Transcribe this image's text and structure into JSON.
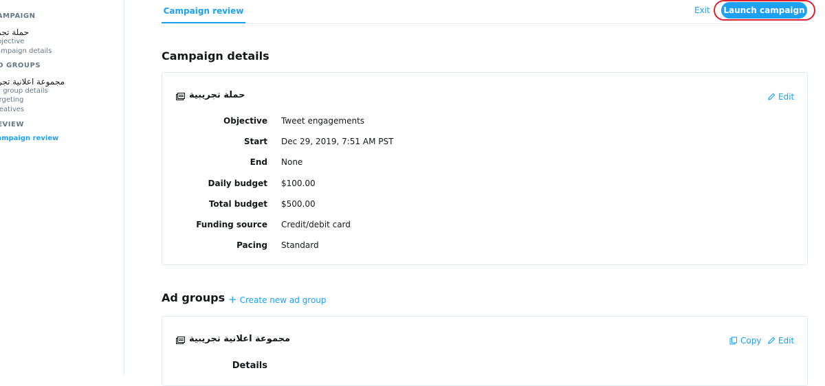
{
  "sidebar": {
    "campaign_heading": "CAMPAIGN",
    "campaign_name": "حملة تجريبية",
    "campaign_items": [
      "Objective",
      "Campaign details"
    ],
    "groups_heading": "AD GROUPS",
    "group_name": "مجموعة اعلانية تجريبية",
    "group_items": [
      "Ad group details",
      "Targeting",
      "Creatives"
    ],
    "review_heading": "REVIEW",
    "review_items": [
      "Campaign review"
    ]
  },
  "header": {
    "tab_label": "Campaign review",
    "exit_label": "Exit",
    "launch_label": "Launch campaign"
  },
  "campaign_details": {
    "heading": "Campaign details",
    "name": "حملة تجريبية",
    "edit_label": "Edit",
    "rows": [
      {
        "label": "Objective",
        "value": "Tweet engagements"
      },
      {
        "label": "Start",
        "value": "Dec 29, 2019, 7:51 AM PST"
      },
      {
        "label": "End",
        "value": "None"
      },
      {
        "label": "Daily budget",
        "value": "$100.00"
      },
      {
        "label": "Total budget",
        "value": "$500.00"
      },
      {
        "label": "Funding source",
        "value": "Credit/debit card"
      },
      {
        "label": "Pacing",
        "value": "Standard"
      }
    ]
  },
  "ad_groups": {
    "heading": "Ad groups",
    "create_label": "Create new ad group",
    "group_name": "مجموعة اعلانية تجريبية",
    "copy_label": "Copy",
    "edit_label": "Edit",
    "details_label": "Details"
  },
  "colors": {
    "accent": "#1da1f2",
    "highlight": "#e0202f"
  }
}
